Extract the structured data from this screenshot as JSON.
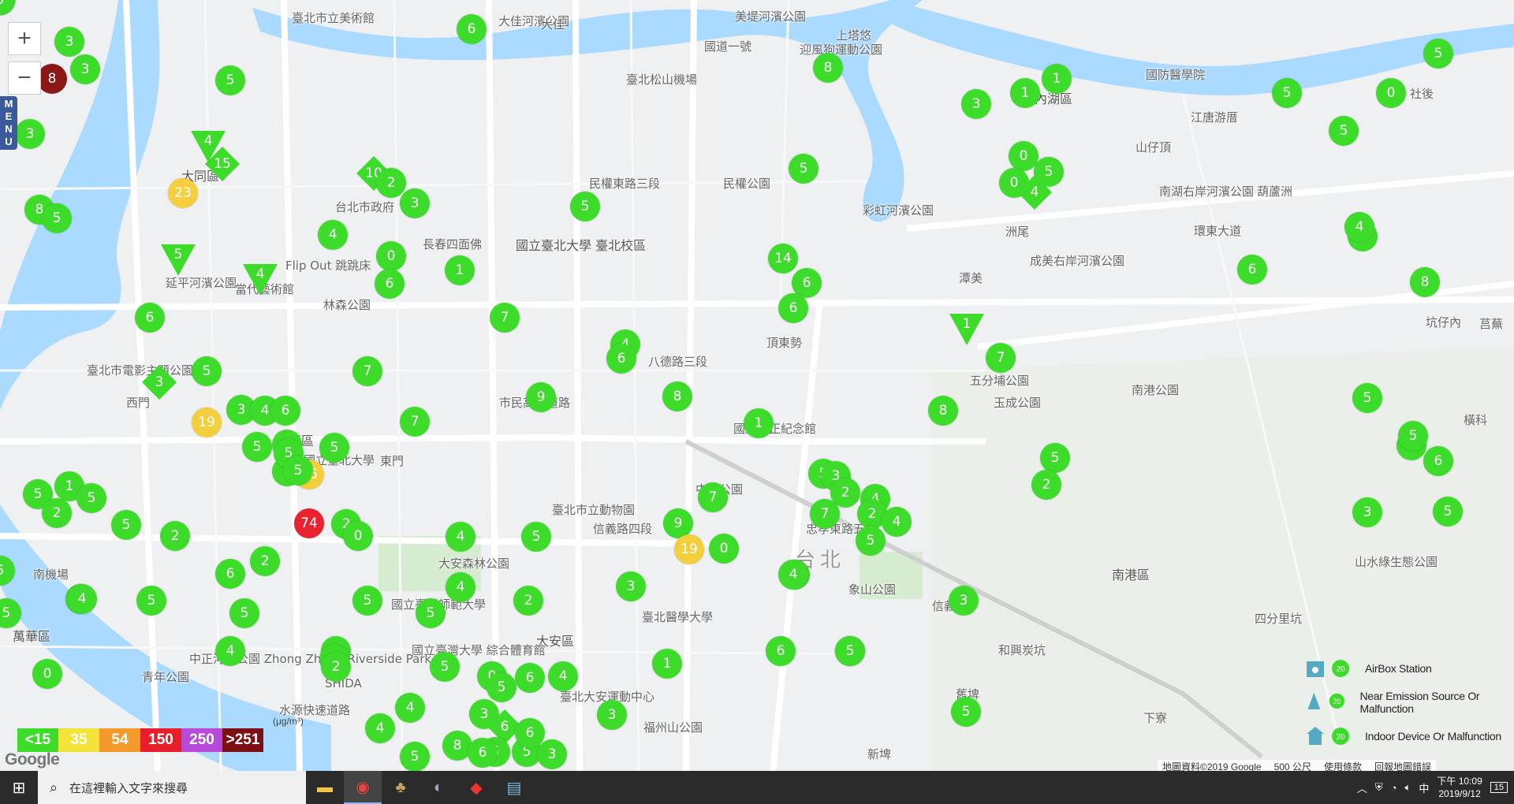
{
  "colors": {
    "green": "#3ddc2a",
    "yellow": "#f3ce3d",
    "red": "#e8222e",
    "maroon": "#8b1717",
    "water": "#aadaff",
    "road": "#ffffff",
    "land": "#eef0f2",
    "park": "#d6ecd0"
  },
  "controls": {
    "zoom_in": "+",
    "zoom_out": "−",
    "menu": "MENU"
  },
  "places": [
    {
      "label": "臺北市立美術館"
    },
    {
      "label": "大佳河濱公園"
    },
    {
      "label": "美堤河濱公園"
    },
    {
      "label": "國道一號"
    },
    {
      "label": "臺北松山機場"
    },
    {
      "label": "迎風狗運動公園"
    },
    {
      "label": "上塔悠"
    },
    {
      "label": "內湖區"
    },
    {
      "label": "國防醫學院"
    },
    {
      "label": "江唐游厝"
    },
    {
      "label": "山仔頂"
    },
    {
      "label": "社後"
    },
    {
      "label": "南湖右岸河濱公園"
    },
    {
      "label": "葫蘆洲"
    },
    {
      "label": "環東大道"
    },
    {
      "label": "大同區"
    },
    {
      "label": "台北市政府"
    },
    {
      "label": "民權公園"
    },
    {
      "label": "民權東路三段"
    },
    {
      "label": "彩虹河濱公園"
    },
    {
      "label": "洲尾"
    },
    {
      "label": "成美右岸河濱公園"
    },
    {
      "label": "延平河濱公園"
    },
    {
      "label": "國立臺北大學 臺北校區"
    },
    {
      "label": "Flip Out 跳跳床"
    },
    {
      "label": "長春四面佛"
    },
    {
      "label": "當代藝術館"
    },
    {
      "label": "林森公園"
    },
    {
      "label": "潭美"
    },
    {
      "label": "頂東勢"
    },
    {
      "label": "臺北市電影主題公園"
    },
    {
      "label": "市民高架道路"
    },
    {
      "label": "八德路三段"
    },
    {
      "label": "五分埔公園"
    },
    {
      "label": "南港公園"
    },
    {
      "label": "坑仔內"
    },
    {
      "label": "國立中正紀念館"
    },
    {
      "label": "玉成公園"
    },
    {
      "label": "西門"
    },
    {
      "label": "中正區"
    },
    {
      "label": "東門"
    },
    {
      "label": "國立臺北大學"
    },
    {
      "label": "中山公園"
    },
    {
      "label": "台北"
    },
    {
      "label": "忠孝東路五段"
    },
    {
      "label": "臺北市立動物園"
    },
    {
      "label": "大安森林公園"
    },
    {
      "label": "信義路四段"
    },
    {
      "label": "象山公園"
    },
    {
      "label": "信義"
    },
    {
      "label": "南港區"
    },
    {
      "label": "山水綠生態公園"
    },
    {
      "label": "四分里坑"
    },
    {
      "label": "萬華區"
    },
    {
      "label": "南機場"
    },
    {
      "label": "國立臺灣師範大學"
    },
    {
      "label": "大安區"
    },
    {
      "label": "臺北醫學大學"
    },
    {
      "label": "和興炭坑"
    },
    {
      "label": "青年公園"
    },
    {
      "label": "SHIDA"
    },
    {
      "label": "國立臺灣大學 綜合體育館"
    },
    {
      "label": "臺北大安運動中心"
    },
    {
      "label": "福州山公園"
    },
    {
      "label": "水源快速道路"
    },
    {
      "label": "中正河濱公園 Zhong Zheng Riverside Park"
    },
    {
      "label": "舊埤"
    },
    {
      "label": "下寮"
    },
    {
      "label": "新埤"
    },
    {
      "label": "橫科"
    },
    {
      "label": "莒蕪"
    },
    {
      "label": "大佳"
    }
  ],
  "markers": [
    {
      "v": "3",
      "c": "green"
    },
    {
      "v": "3",
      "c": "green"
    },
    {
      "v": "8",
      "c": "maroon"
    },
    {
      "v": "6",
      "c": "green"
    },
    {
      "v": "5",
      "c": "green"
    },
    {
      "v": "8",
      "c": "green"
    },
    {
      "v": "1",
      "c": "green"
    },
    {
      "v": "5",
      "c": "green"
    },
    {
      "v": "0",
      "c": "green"
    },
    {
      "v": "1",
      "c": "green"
    },
    {
      "v": "3",
      "c": "green"
    },
    {
      "v": "5",
      "c": "green"
    },
    {
      "v": "5",
      "c": "green"
    },
    {
      "v": "4",
      "c": "green",
      "s": "tri"
    },
    {
      "v": "15",
      "c": "green",
      "s": "dia"
    },
    {
      "v": "10",
      "c": "green",
      "s": "dia"
    },
    {
      "v": "2",
      "c": "green"
    },
    {
      "v": "3",
      "c": "green"
    },
    {
      "v": "23",
      "c": "yellow"
    },
    {
      "v": "5",
      "c": "green"
    },
    {
      "v": "0",
      "c": "green"
    },
    {
      "v": "5",
      "c": "green"
    },
    {
      "v": "0",
      "c": "green"
    },
    {
      "v": "4",
      "c": "green",
      "s": "dia"
    },
    {
      "v": "5",
      "c": "green"
    },
    {
      "v": "3",
      "c": "green"
    },
    {
      "v": "8",
      "c": "green"
    },
    {
      "v": "5",
      "c": "green"
    },
    {
      "v": "4",
      "c": "green"
    },
    {
      "v": "5",
      "c": "green",
      "s": "tri"
    },
    {
      "v": "0",
      "c": "green"
    },
    {
      "v": "1",
      "c": "green"
    },
    {
      "v": "6",
      "c": "green"
    },
    {
      "v": "4",
      "c": "green",
      "s": "tri"
    },
    {
      "v": "14",
      "c": "green"
    },
    {
      "v": "6",
      "c": "green"
    },
    {
      "v": "6",
      "c": "green"
    },
    {
      "v": "6",
      "c": "green"
    },
    {
      "v": "5",
      "c": "green"
    },
    {
      "v": "4",
      "c": "green"
    },
    {
      "v": "8",
      "c": "green"
    },
    {
      "v": "7",
      "c": "green"
    },
    {
      "v": "4",
      "c": "green"
    },
    {
      "v": "6",
      "c": "green"
    },
    {
      "v": "1",
      "c": "green",
      "s": "tri"
    },
    {
      "v": "7",
      "c": "green"
    },
    {
      "v": "3",
      "c": "green",
      "s": "dia"
    },
    {
      "v": "5",
      "c": "green"
    },
    {
      "v": "7",
      "c": "green"
    },
    {
      "v": "6",
      "c": "green"
    },
    {
      "v": "5",
      "c": "green"
    },
    {
      "v": "8",
      "c": "green"
    },
    {
      "v": "1",
      "c": "green"
    },
    {
      "v": "8",
      "c": "green"
    },
    {
      "v": "9",
      "c": "green"
    },
    {
      "v": "3",
      "c": "green"
    },
    {
      "v": "4",
      "c": "green"
    },
    {
      "v": "6",
      "c": "green"
    },
    {
      "v": "19",
      "c": "yellow"
    },
    {
      "v": "7",
      "c": "green"
    },
    {
      "v": "5",
      "c": "green"
    },
    {
      "v": "5",
      "c": "green"
    },
    {
      "v": "1",
      "c": "green"
    },
    {
      "v": "26",
      "c": "yellow"
    },
    {
      "v": "4",
      "c": "green"
    },
    {
      "v": "5",
      "c": "green"
    },
    {
      "v": "5",
      "c": "green"
    },
    {
      "v": "8",
      "c": "green"
    },
    {
      "v": "6",
      "c": "green"
    },
    {
      "v": "5",
      "c": "green"
    },
    {
      "v": "1",
      "c": "green"
    },
    {
      "v": "5",
      "c": "green"
    },
    {
      "v": "2",
      "c": "green"
    },
    {
      "v": "5",
      "c": "green"
    },
    {
      "v": "7",
      "c": "green"
    },
    {
      "v": "5",
      "c": "green"
    },
    {
      "v": "3",
      "c": "green"
    },
    {
      "v": "2",
      "c": "green"
    },
    {
      "v": "4",
      "c": "green"
    },
    {
      "v": "7",
      "c": "green"
    },
    {
      "v": "5",
      "c": "green"
    },
    {
      "v": "2",
      "c": "green"
    },
    {
      "v": "74",
      "c": "red"
    },
    {
      "v": "2",
      "c": "green"
    },
    {
      "v": "0",
      "c": "green"
    },
    {
      "v": "4",
      "c": "green"
    },
    {
      "v": "5",
      "c": "green"
    },
    {
      "v": "9",
      "c": "green"
    },
    {
      "v": "19",
      "c": "yellow"
    },
    {
      "v": "0",
      "c": "green"
    },
    {
      "v": "2",
      "c": "green"
    },
    {
      "v": "3",
      "c": "green"
    },
    {
      "v": "5",
      "c": "green"
    },
    {
      "v": "2",
      "c": "green"
    },
    {
      "v": "4",
      "c": "green"
    },
    {
      "v": "5",
      "c": "green"
    },
    {
      "v": "4",
      "c": "green"
    },
    {
      "v": "2",
      "c": "green"
    },
    {
      "v": "6",
      "c": "green"
    },
    {
      "v": "5",
      "c": "green"
    },
    {
      "v": "5",
      "c": "green"
    },
    {
      "v": "3",
      "c": "green"
    },
    {
      "v": "5",
      "c": "green"
    },
    {
      "v": "5",
      "c": "green"
    },
    {
      "v": "5",
      "c": "green"
    },
    {
      "v": "4",
      "c": "green"
    },
    {
      "v": "5",
      "c": "green"
    },
    {
      "v": "5",
      "c": "green"
    },
    {
      "v": "5",
      "c": "green"
    },
    {
      "v": "2",
      "c": "green"
    },
    {
      "v": "4",
      "c": "green"
    },
    {
      "v": "3",
      "c": "green"
    },
    {
      "v": "3",
      "c": "green"
    },
    {
      "v": "2",
      "c": "green"
    },
    {
      "v": "1",
      "c": "green"
    },
    {
      "v": "4",
      "c": "green"
    },
    {
      "v": "2",
      "c": "green"
    },
    {
      "v": "0",
      "c": "green"
    },
    {
      "v": "6",
      "c": "green"
    },
    {
      "v": "4",
      "c": "green"
    },
    {
      "v": "1",
      "c": "green"
    },
    {
      "v": "5",
      "c": "green"
    },
    {
      "v": "5",
      "c": "green"
    },
    {
      "v": "3",
      "c": "green"
    },
    {
      "v": "6",
      "c": "green",
      "s": "dia"
    },
    {
      "v": "4",
      "c": "green"
    },
    {
      "v": "3",
      "c": "green"
    },
    {
      "v": "5",
      "c": "green"
    },
    {
      "v": "5",
      "c": "green"
    },
    {
      "v": "6",
      "c": "green"
    },
    {
      "v": "8",
      "c": "green"
    },
    {
      "v": "5",
      "c": "green"
    },
    {
      "v": "6",
      "c": "green"
    },
    {
      "v": "3",
      "c": "green"
    },
    {
      "v": "5",
      "c": "green"
    },
    {
      "v": "4",
      "c": "green"
    },
    {
      "v": "5",
      "c": "green"
    },
    {
      "v": "6",
      "c": "green"
    },
    {
      "v": "5",
      "c": "green"
    },
    {
      "v": "0",
      "c": "green"
    },
    {
      "v": "5",
      "c": "green"
    },
    {
      "v": "5",
      "c": "green"
    },
    {
      "v": "1",
      "c": "green"
    },
    {
      "v": "5",
      "c": "green"
    }
  ],
  "aqi_scale": {
    "unit": "(μg/m³)",
    "items": [
      {
        "label": "<15",
        "color": "#3ddc2a"
      },
      {
        "label": "35",
        "color": "#f4e43a"
      },
      {
        "label": "54",
        "color": "#f39a2a"
      },
      {
        "label": "150",
        "color": "#e81e2b"
      },
      {
        "label": "250",
        "color": "#b74ad8"
      },
      {
        "label": ">251",
        "color": "#7b0f14"
      }
    ]
  },
  "legend": [
    {
      "label": "AirBox Station",
      "icon": "airbox-station-icon"
    },
    {
      "label": "Near Emission Source Or Malfunction",
      "icon": "emission-source-icon"
    },
    {
      "label": "Indoor Device Or Malfunction",
      "icon": "indoor-device-icon"
    }
  ],
  "google": {
    "logo": "Google",
    "data": "地圖資料©2019 Google",
    "scale": "500 公尺",
    "terms": "使用條款",
    "report": "回報地圖錯誤"
  },
  "taskbar": {
    "search_placeholder": "在這裡輸入文字來搜尋",
    "time": "下午 10:09",
    "date": "2019/9/12",
    "ime": "中",
    "notifications": "15"
  }
}
